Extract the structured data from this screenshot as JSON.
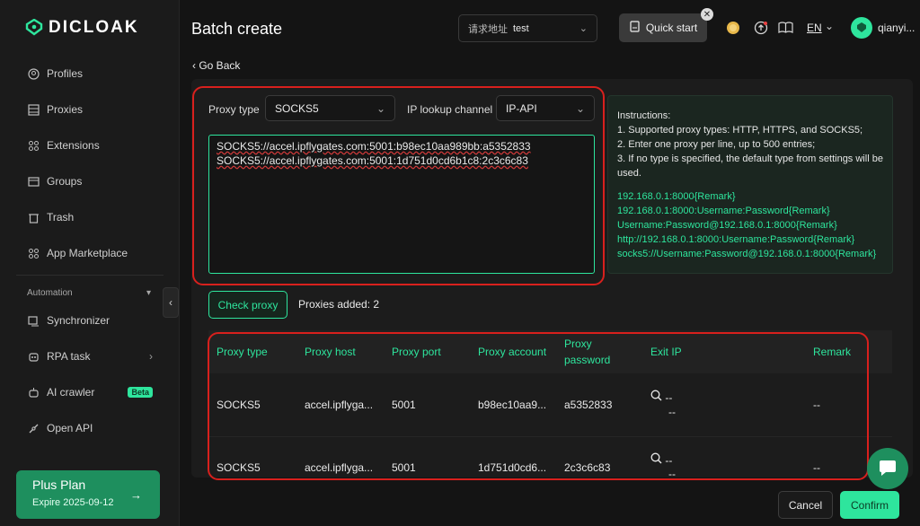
{
  "brand": {
    "name": "DICLOAK"
  },
  "sidebar": {
    "items": [
      {
        "label": "Profiles",
        "icon": "profiles-icon"
      },
      {
        "label": "Proxies",
        "icon": "proxies-icon"
      },
      {
        "label": "Extensions",
        "icon": "extensions-icon"
      },
      {
        "label": "Groups",
        "icon": "groups-icon"
      },
      {
        "label": "Trash",
        "icon": "trash-icon"
      },
      {
        "label": "App Marketplace",
        "icon": "marketplace-icon"
      }
    ],
    "section_label": "Automation",
    "automation_items": [
      {
        "label": "Synchronizer",
        "icon": "synchronizer-icon"
      },
      {
        "label": "RPA task",
        "icon": "rpa-icon"
      },
      {
        "label": "AI crawler",
        "icon": "ai-crawler-icon",
        "badge": "Beta"
      },
      {
        "label": "Open API",
        "icon": "api-icon"
      }
    ],
    "plan": {
      "name": "Plus Plan",
      "expire": "Expire 2025-09-12"
    }
  },
  "header": {
    "title": "Batch create",
    "request_label": "请求地址",
    "request_value": "test",
    "quick_start": "Quick start",
    "lang": "EN",
    "username": "qianyi..."
  },
  "go_back": "Go Back",
  "form": {
    "proxy_type_label": "Proxy type",
    "proxy_type_value": "SOCKS5",
    "lookup_label": "IP lookup channel",
    "lookup_value": "IP-API",
    "lines": [
      "SOCKS5://accel.ipflygates.com:5001:b98ec10aa989bb:a5352833",
      "SOCKS5://accel.ipflygates.com:5001:1d751d0cd6b1c8:2c3c6c83"
    ]
  },
  "instructions": {
    "title": "Instructions:",
    "rules": [
      "1. Supported proxy types: HTTP, HTTPS, and SOCKS5;",
      "2. Enter one proxy per line, up to 500 entries;",
      "3. If no type is specified, the default type from settings will be used."
    ],
    "examples": [
      "192.168.0.1:8000{Remark}",
      "192.168.0.1:8000:Username:Password{Remark}",
      "Username:Password@192.168.0.1:8000{Remark}",
      "http://192.168.0.1:8000:Username:Password{Remark}",
      "socks5://Username:Password@192.168.0.1:8000{Remark}"
    ]
  },
  "check": {
    "button": "Check proxy",
    "added": "Proxies added: 2"
  },
  "table": {
    "headers": {
      "type": "Proxy type",
      "host": "Proxy host",
      "port": "Proxy port",
      "account": "Proxy account",
      "password_line1": "Proxy",
      "password_line2": "password",
      "exit_ip": "Exit IP",
      "remark": "Remark"
    },
    "rows": [
      {
        "type": "SOCKS5",
        "host": "accel.ipflyga...",
        "port": "5001",
        "account": "b98ec10aa9...",
        "password": "a5352833",
        "exit_ip_1": "--",
        "exit_ip_2": "--",
        "remark": "--"
      },
      {
        "type": "SOCKS5",
        "host": "accel.ipflyga...",
        "port": "5001",
        "account": "1d751d0cd6...",
        "password": "2c3c6c83",
        "exit_ip_1": "--",
        "exit_ip_2": "--",
        "remark": "--"
      }
    ]
  },
  "footer": {
    "cancel": "Cancel",
    "confirm": "Confirm"
  },
  "colors": {
    "accent": "#2ee59d",
    "highlight": "#d8201d"
  }
}
